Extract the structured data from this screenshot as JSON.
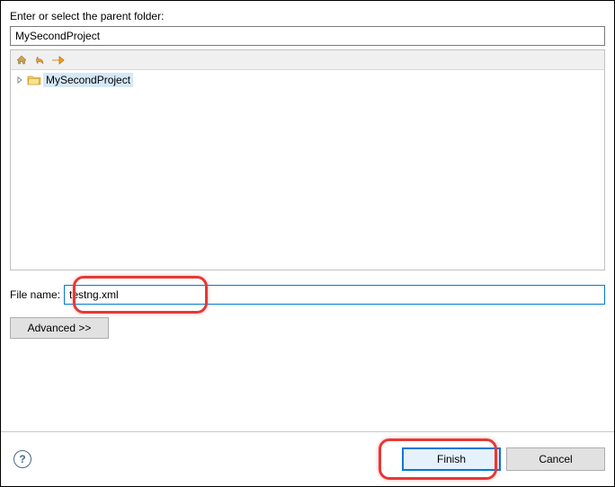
{
  "labels": {
    "parent_folder": "Enter or select the parent folder:",
    "file_name": "File name:"
  },
  "inputs": {
    "parent_folder_value": "MySecondProject",
    "file_name_value": "testng.xml"
  },
  "tree": {
    "items": [
      {
        "label": "MySecondProject"
      }
    ]
  },
  "buttons": {
    "advanced": "Advanced >>",
    "finish": "Finish",
    "cancel": "Cancel"
  },
  "icons": {
    "home": "home-icon",
    "back": "back-icon",
    "forward": "forward-icon",
    "folder": "folder-icon",
    "help": "?"
  }
}
